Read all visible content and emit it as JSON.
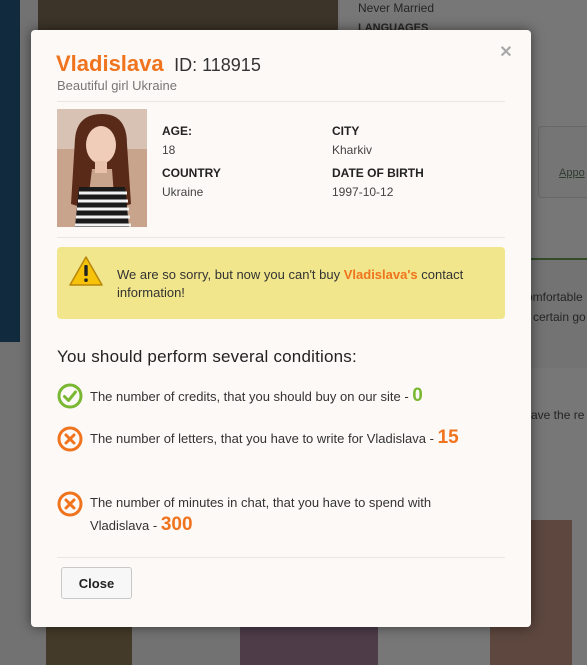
{
  "background": {
    "side_text_1": "Never Married",
    "side_text_2": "LANGUAGES",
    "app_card_label": "Appo",
    "snippet_1": "omfortable",
    "snippet_2": "certain go",
    "snippet_3": "ave the re"
  },
  "modal": {
    "name": "Vladislava",
    "id_label": "ID: 118915",
    "subtitle": "Beautiful girl Ukraine",
    "close_icon": "close-icon",
    "profile": {
      "age_label": "AGE:",
      "age_value": "18",
      "city_label": "CITY",
      "city_value": "Kharkiv",
      "country_label": "COUNTRY",
      "country_value": "Ukraine",
      "dob_label": "DATE OF BIRTH",
      "dob_value": "1997-10-12"
    },
    "alert": {
      "text_before": "We are so sorry, but now you can't buy ",
      "highlight": "Vladislava's",
      "text_after": " contact information!",
      "icon": "warning-icon"
    },
    "conditions_title": "You should perform several conditions:",
    "conditions": [
      {
        "text": "The number of credits, that you should buy on our site - ",
        "value": "0",
        "status": "done",
        "icon": "check-circle-icon"
      },
      {
        "text": "The number of letters, that you have to write for Vladislava - ",
        "value": "15",
        "status": "todo",
        "icon": "x-circle-icon"
      },
      {
        "text": "The number of minutes in chat, that you have to spend with Vladislava - ",
        "value": "300",
        "status": "todo",
        "icon": "x-circle-icon"
      }
    ],
    "close_button_label": "Close"
  },
  "colors": {
    "accent": "#f0731e",
    "success": "#7ab833",
    "alert_bg": "#f1e68b"
  }
}
